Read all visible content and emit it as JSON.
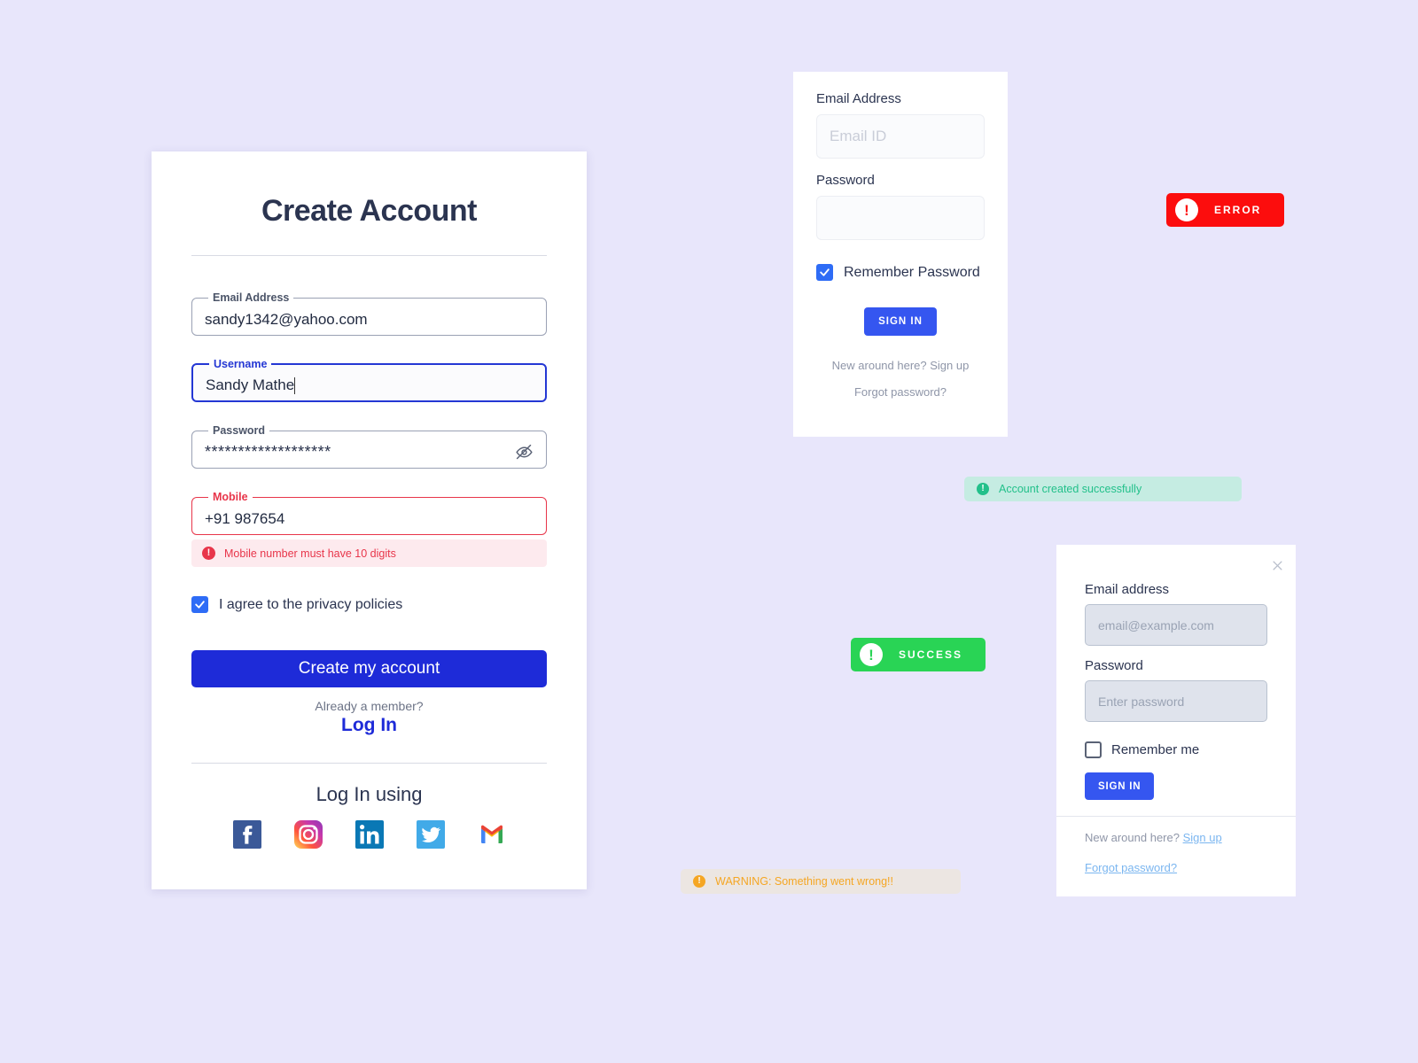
{
  "signup": {
    "title": "Create Account",
    "email": {
      "label": "Email Address",
      "value": "sandy1342@yahoo.com"
    },
    "username": {
      "label": "Username",
      "value": "Sandy Mathe"
    },
    "password": {
      "label": "Password",
      "value": "*******************",
      "toggle_icon": "eye-off-icon"
    },
    "mobile": {
      "label": "Mobile",
      "value": "+91 987654",
      "error": "Mobile number must have 10 digits",
      "error_icon": "!"
    },
    "privacy": {
      "label": "I agree to the privacy policies",
      "checked": true
    },
    "submit_label": "Create my account",
    "already_member": "Already a member?",
    "login_link": "Log In",
    "social_title": "Log In using",
    "socials": [
      {
        "name": "facebook-icon",
        "label": "Facebook"
      },
      {
        "name": "instagram-icon",
        "label": "Instagram"
      },
      {
        "name": "linkedin-icon",
        "label": "LinkedIn"
      },
      {
        "name": "twitter-icon",
        "label": "Twitter"
      },
      {
        "name": "gmail-icon",
        "label": "Gmail"
      }
    ]
  },
  "signin": {
    "email_label": "Email Address",
    "email_placeholder": "Email ID",
    "email_value": "",
    "password_label": "Password",
    "password_placeholder": "",
    "password_value": "",
    "remember_label": "Remember Password",
    "remember_checked": true,
    "submit_label": "SIGN IN",
    "signup_link": "New around here? Sign up",
    "forgot_link": "Forgot password?"
  },
  "signin2": {
    "close_icon": "close-icon",
    "email_label": "Email address",
    "email_placeholder": "email@example.com",
    "email_value": "",
    "password_label": "Password",
    "password_placeholder": "Enter password",
    "password_value": "",
    "remember_label": "Remember me",
    "remember_checked": false,
    "submit_label": "SIGN IN",
    "signup_prefix": "New around here? ",
    "signup_link": "Sign up",
    "forgot_link": "Forgot password?"
  },
  "badges": {
    "error": {
      "text": "ERROR",
      "glyph": "!",
      "color": "#fc0d0d"
    },
    "success": {
      "text": "SUCCESS",
      "glyph": "!",
      "color": "#29d455"
    }
  },
  "toasts": {
    "success": {
      "text": "Account created successfully",
      "glyph": "!",
      "color": "#22c08a"
    },
    "warning": {
      "text": "WARNING: Something went wrong!!",
      "glyph": "!",
      "color": "#f5a623"
    }
  },
  "theme": {
    "background": "#e8e6fb",
    "primary": "#1e2bd8",
    "accent_blue": "#3556f0",
    "error": "#e8354a"
  }
}
